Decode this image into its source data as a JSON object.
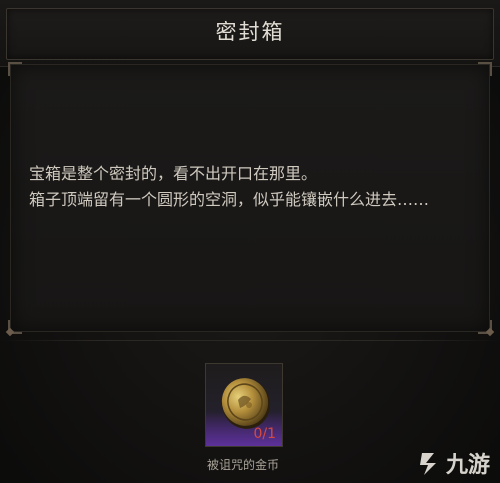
{
  "header": {
    "title": "密封箱"
  },
  "description": {
    "text": "宝箱是整个密封的，看不出开口在那里。\n箱子顶端留有一个圆形的空洞，似乎能镶嵌什么进去……"
  },
  "required_item": {
    "name": "被诅咒的金币",
    "count": "0/1",
    "icon": "cursed-gold-coin-icon"
  },
  "watermark": {
    "text": "九游",
    "icon": "jiuyou-logo-icon"
  },
  "colors": {
    "title": "#e2ddd4",
    "text": "#cfc9bf",
    "counter": "#d64a3e",
    "slot_glow": "#7a3cc8"
  }
}
